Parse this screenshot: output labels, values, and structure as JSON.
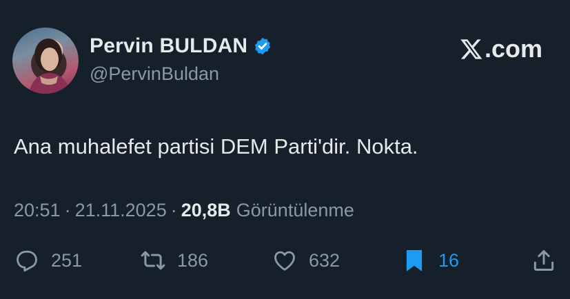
{
  "author": {
    "display_name": "Pervin BULDAN",
    "handle": "@PervinBuldan",
    "verified": true,
    "avatar_icon": "profile-photo"
  },
  "brand": {
    "label": ".com",
    "icon": "x-logo-icon"
  },
  "tweet": {
    "text": "Ana muhalefet partisi DEM Parti'dir. Nokta.",
    "time": "20:51",
    "sep1": "·",
    "date": "21.11.2025",
    "sep2": "·",
    "views_count": "20,8B",
    "views_label": "Görüntülenme"
  },
  "actions": {
    "reply": {
      "count": "251",
      "icon": "reply-icon"
    },
    "retweet": {
      "count": "186",
      "icon": "retweet-icon"
    },
    "like": {
      "count": "632",
      "icon": "heart-icon"
    },
    "bookmark": {
      "count": "16",
      "icon": "bookmark-icon",
      "active": true
    },
    "share": {
      "icon": "share-icon"
    }
  },
  "colors": {
    "background": "#15202b",
    "text": "#e7e9ea",
    "muted": "#8b98a5",
    "accent": "#1d9bf0"
  }
}
